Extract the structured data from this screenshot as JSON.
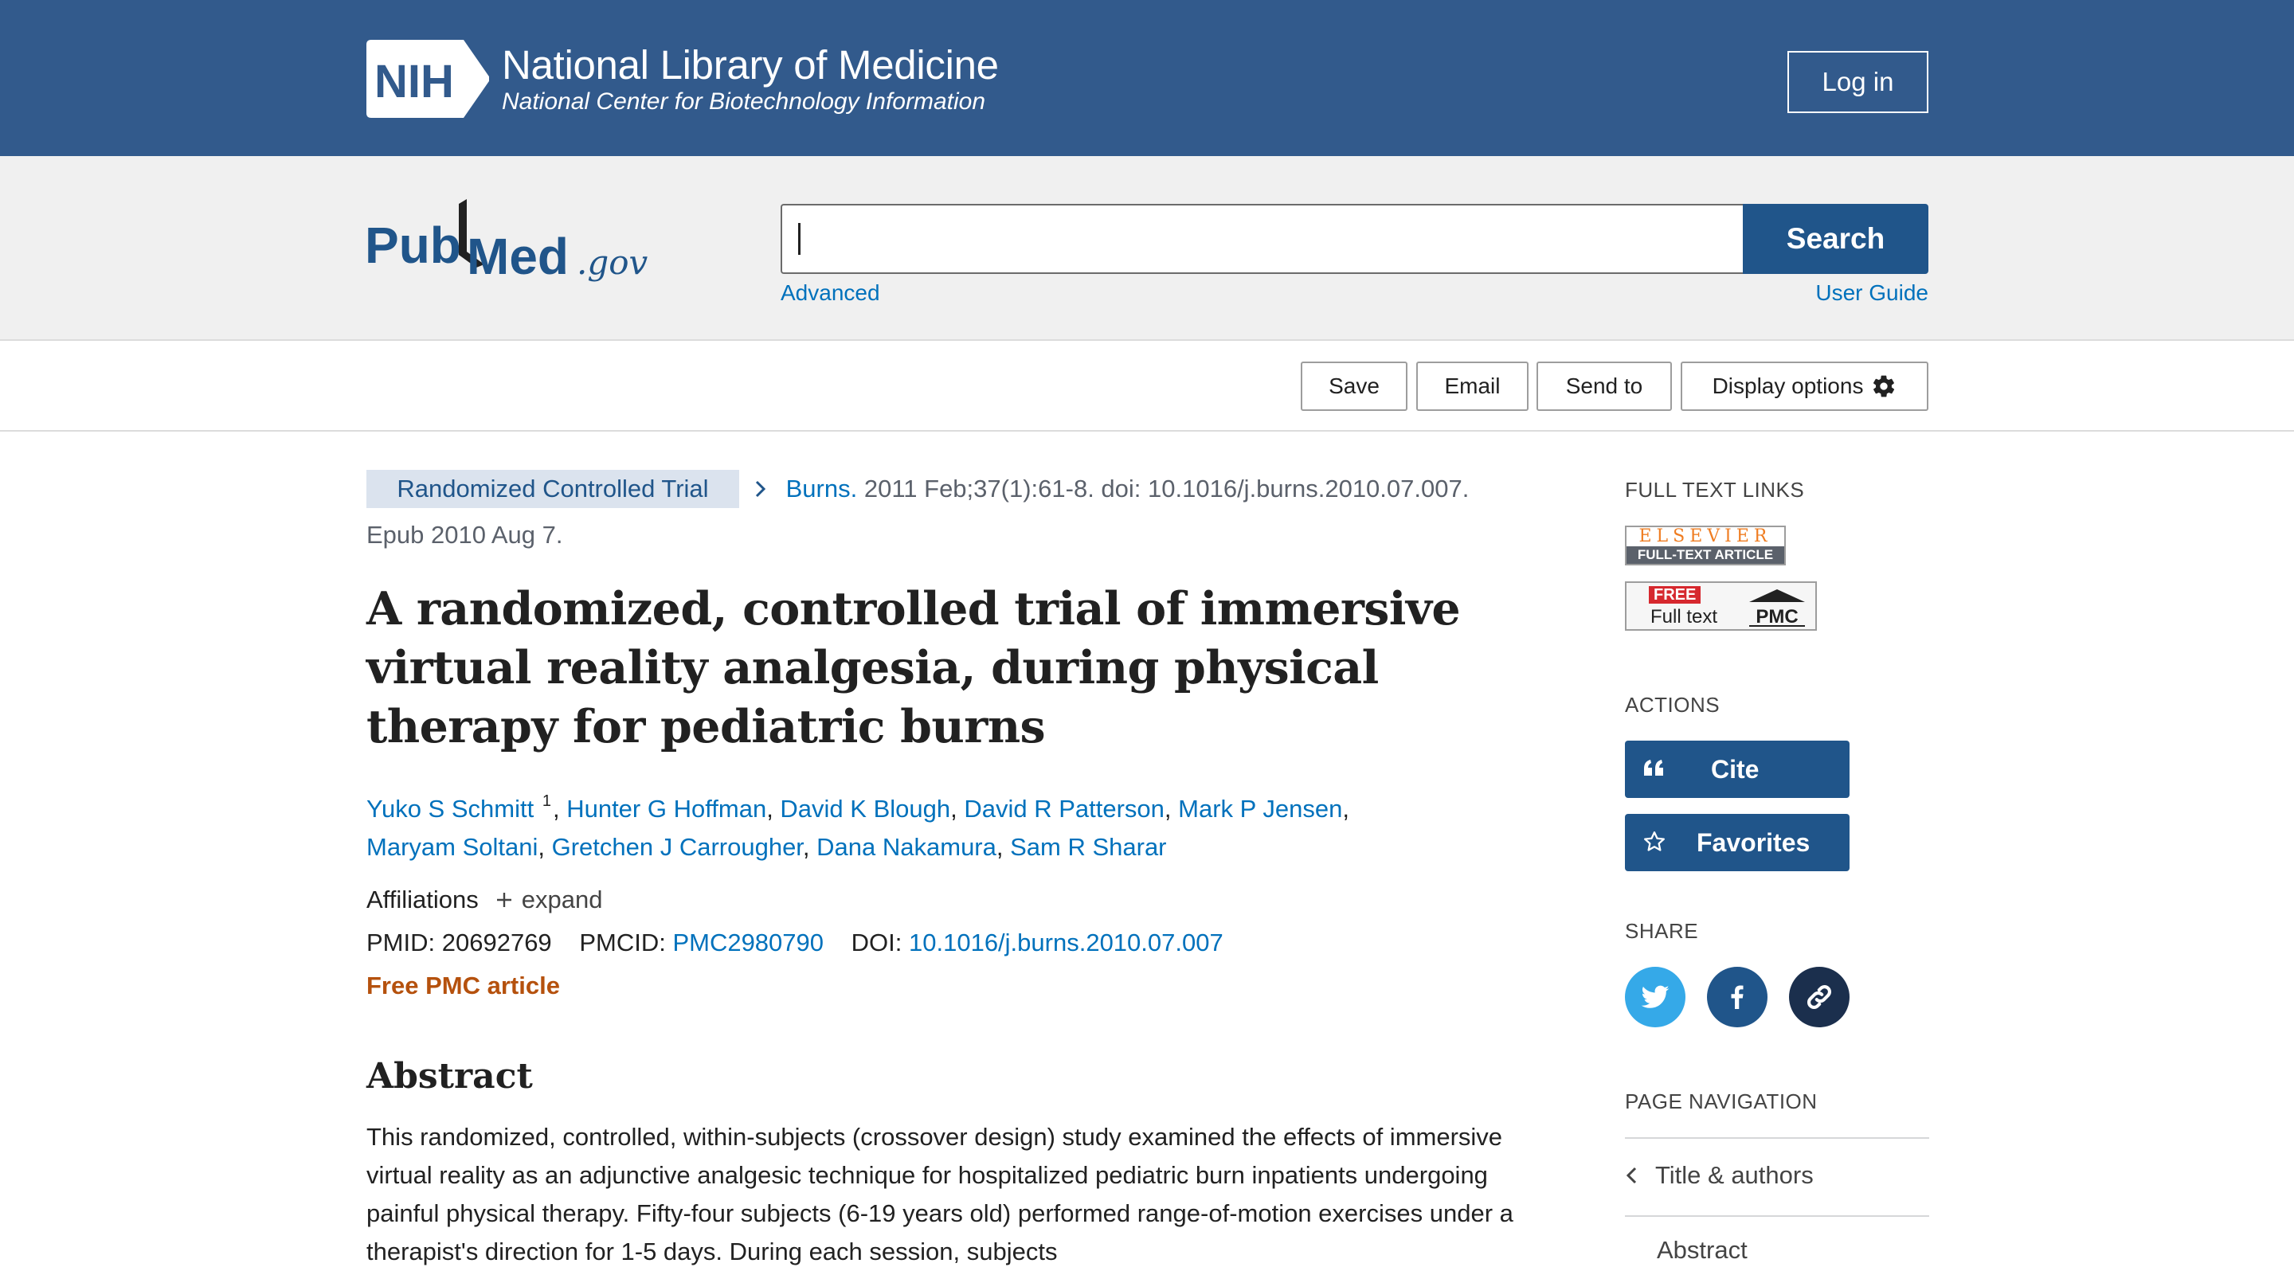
{
  "nih_banner": {
    "logo_text": "NIH",
    "title": "National Library of Medicine",
    "subtitle": "National Center for Biotechnology Information",
    "login_label": "Log in"
  },
  "search": {
    "logo_text_pub": "Pub",
    "logo_text_med": "Med",
    "logo_text_gov": ".gov",
    "query": "",
    "search_label": "Search",
    "advanced_label": "Advanced",
    "user_guide_label": "User Guide"
  },
  "toolbar": {
    "save_label": "Save",
    "email_label": "Email",
    "send_to_label": "Send to",
    "display_options_label": "Display options"
  },
  "article": {
    "publication_type": "Randomized Controlled Trial",
    "journal": "Burns.",
    "citation_details": "2011 Feb;37(1):61-8. doi: 10.1016/j.burns.2010.07.007.",
    "epub": "Epub 2010 Aug 7.",
    "title": "A randomized, controlled trial of immersive virtual reality analgesia, during physical therapy for pediatric burns",
    "authors": [
      "Yuko S Schmitt",
      "Hunter G Hoffman",
      "David K Blough",
      "David R Patterson",
      "Mark P Jensen",
      "Maryam Soltani",
      "Gretchen J Carrougher",
      "Dana Nakamura",
      "Sam R Sharar"
    ],
    "first_author_affiliation_marker": "1",
    "affiliations_label": "Affiliations",
    "expand_label": "expand",
    "pmid_label": "PMID:",
    "pmid": "20692769",
    "pmcid_label": "PMCID:",
    "pmcid": "PMC2980790",
    "doi_label": "DOI:",
    "doi": "10.1016/j.burns.2010.07.007",
    "free_pmc_label": "Free PMC article",
    "abstract_heading": "Abstract",
    "abstract_text": "This randomized, controlled, within-subjects (crossover design) study examined the effects of immersive virtual reality as an adjunctive analgesic technique for hospitalized pediatric burn inpatients undergoing painful physical therapy. Fifty-four subjects (6-19 years old) performed range-of-motion exercises under a therapist's direction for 1-5 days. During each session, subjects"
  },
  "sidebar": {
    "full_text_links_label": "FULL TEXT LINKS",
    "elsevier_top": "ELSEVIER",
    "elsevier_bottom": "FULL-TEXT ARTICLE",
    "pmc_free": "FREE",
    "pmc_full_text": "Full text",
    "pmc_logo": "PMC",
    "actions_label": "ACTIONS",
    "cite_label": "Cite",
    "favorites_label": "Favorites",
    "share_label": "SHARE",
    "page_navigation_label": "PAGE NAVIGATION",
    "nav_items": [
      "Title & authors",
      "Abstract"
    ]
  },
  "colors": {
    "nih_blue": "#325a8c",
    "button_blue": "#20558a",
    "link_blue": "#0071bc",
    "free_pmc_orange": "#b5510d",
    "twitter": "#35a9e8",
    "facebook": "#20558a",
    "link_share": "#1b2f4d"
  },
  "icons": {
    "display_options": "gear-icon",
    "cite": "quote-icon",
    "favorites": "star-icon",
    "share_twitter": "twitter-icon",
    "share_facebook": "facebook-icon",
    "share_link": "link-icon",
    "nav_back": "chevron-left-icon",
    "breadcrumb": "chevron-right-icon",
    "expand": "plus-icon"
  }
}
